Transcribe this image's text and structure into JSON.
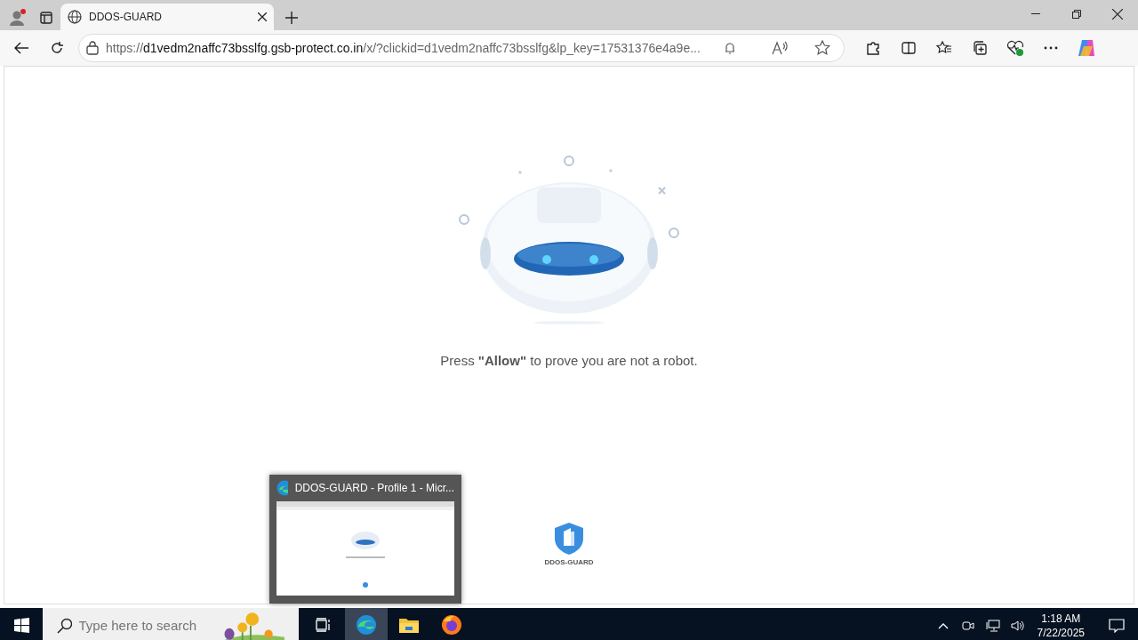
{
  "browser": {
    "tabs": [
      {
        "title": "DDOS-GUARD",
        "selected": true
      }
    ],
    "address": {
      "scheme": "https://",
      "host": "d1vedm2naffc73bsslfg.gsb-protect.co.in",
      "path": "/x/?clickid=d1vedm2naffc73bsslfg&lp_key=17531376e4a9e..."
    }
  },
  "page": {
    "prompt": "Press **\"Allow\"** to prove you are not a robot.",
    "logo_text": "DDOS-GUARD"
  },
  "preview": {
    "title": "DDOS-GUARD - Profile 1 - Micr..."
  },
  "taskbar": {
    "search_placeholder": "Type here to search",
    "apps": [
      {
        "kind": "taskview",
        "selected": false
      },
      {
        "kind": "edge",
        "selected": true
      },
      {
        "kind": "files",
        "selected": false
      },
      {
        "kind": "firefox",
        "selected": false
      }
    ],
    "time": "1:18 AM",
    "date": "7/22/2025"
  }
}
